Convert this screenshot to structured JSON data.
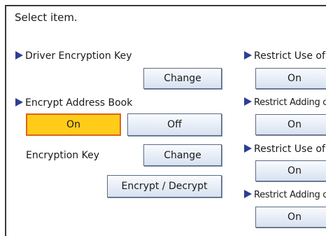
{
  "header": {
    "title": "Select item."
  },
  "left": {
    "driver_key": {
      "label": "Driver Encryption Key",
      "change_label": "Change"
    },
    "address_book": {
      "label": "Encrypt Address Book",
      "on_label": "On",
      "off_label": "Off",
      "selected": "On"
    },
    "encryption_key": {
      "label": "Encryption Key",
      "change_label": "Change",
      "encrypt_decrypt_label": "Encrypt / Decrypt"
    }
  },
  "right": {
    "items": [
      {
        "label": "Restrict Use of",
        "button_label": "On"
      },
      {
        "label": "Restrict Adding of",
        "button_label": "On"
      },
      {
        "label": "Restrict Use of",
        "button_label": "On"
      },
      {
        "label": "Restrict Adding of",
        "button_label": "On"
      }
    ]
  },
  "colors": {
    "arrow": "#2b3f95",
    "selected_fill": "#ffcc1a",
    "selected_border": "#e0621a"
  }
}
